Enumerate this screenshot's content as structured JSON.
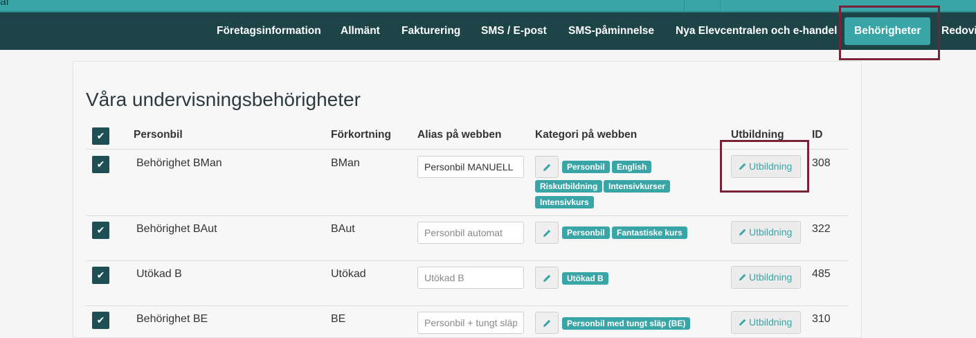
{
  "topbar": {
    "fragment": "al"
  },
  "nav": {
    "items": [
      {
        "label": "Företagsinformation"
      },
      {
        "label": "Allmänt"
      },
      {
        "label": "Fakturering"
      },
      {
        "label": "SMS / E-post"
      },
      {
        "label": "SMS-påminnelse"
      },
      {
        "label": "Nya Elevcentralen och e-handel"
      },
      {
        "label": "Behörigheter",
        "active": true
      },
      {
        "label": "Redovi"
      }
    ]
  },
  "page": {
    "title": "Våra undervisningsbehörigheter"
  },
  "table": {
    "headers": {
      "personbil": "Personbil",
      "forkortning": "Förkortning",
      "alias": "Alias på webben",
      "kategori": "Kategori på webben",
      "utbildning": "Utbildning",
      "id": "ID"
    },
    "rows": [
      {
        "checked": true,
        "name": "Behörighet BMan",
        "abbr": "BMan",
        "alias_value": "Personbil MANUELL",
        "alias_placeholder": "",
        "tags": [
          "Personbil",
          "English",
          "Riskutbildning",
          "Intensivkurser",
          "Intensivkurs"
        ],
        "utbildning_label": "Utbildning",
        "id": "308"
      },
      {
        "checked": true,
        "name": "Behörighet BAut",
        "abbr": "BAut",
        "alias_value": "",
        "alias_placeholder": "Personbil automat",
        "tags": [
          "Personbil",
          "Fantastiske kurs"
        ],
        "utbildning_label": "Utbildning",
        "id": "322"
      },
      {
        "checked": true,
        "name": "Utökad B",
        "abbr": "Utökad",
        "alias_value": "",
        "alias_placeholder": "Utökad B",
        "tags": [
          "Utökad B"
        ],
        "utbildning_label": "Utbildning",
        "id": "485"
      },
      {
        "checked": true,
        "name": "Behörighet BE",
        "abbr": "BE",
        "alias_value": "",
        "alias_placeholder": "Personbil + tungt släp",
        "tags": [
          "Personbil med tungt släp (BE)"
        ],
        "utbildning_label": "Utbildning",
        "id": "310"
      }
    ]
  },
  "icons": {
    "check": "check-icon",
    "edit": "pencil-icon"
  },
  "colors": {
    "navbar": "#1d4548",
    "accent": "#3aa5a6",
    "highlight": "#7a2235",
    "checkbox": "#1d4f54"
  }
}
